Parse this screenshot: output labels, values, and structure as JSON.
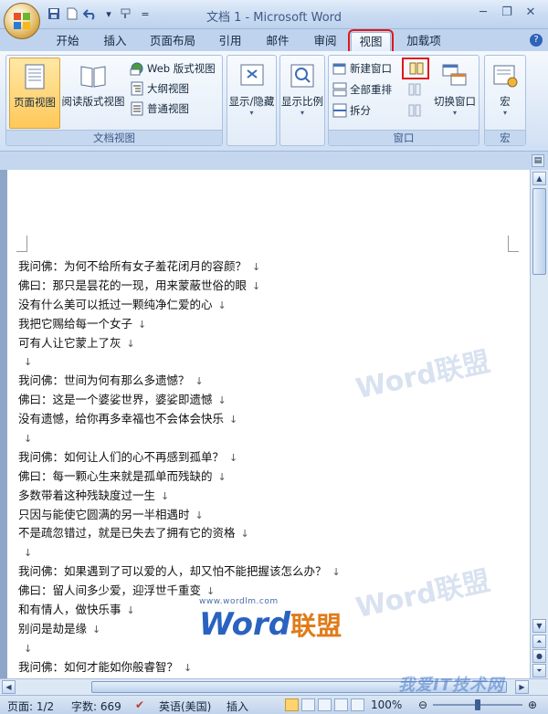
{
  "window": {
    "title": "文档 1 - Microsoft Word"
  },
  "quick_access": [
    "save-icon",
    "new-document-icon",
    "undo-icon",
    "format-painter-icon"
  ],
  "tabs": [
    {
      "label": "开始"
    },
    {
      "label": "插入"
    },
    {
      "label": "页面布局"
    },
    {
      "label": "引用"
    },
    {
      "label": "邮件"
    },
    {
      "label": "审阅"
    },
    {
      "label": "视图",
      "active": true,
      "highlighted": true
    },
    {
      "label": "加载项"
    }
  ],
  "ribbon": {
    "doc_view": {
      "label": "文档视图",
      "print_layout": "页面视图",
      "reading_layout": "阅读版式视图",
      "web_layout": "Web 版式视图",
      "outline": "大纲视图",
      "draft": "普通视图"
    },
    "show_hide": {
      "label": "显示/隐藏"
    },
    "zoom": {
      "label": "显示比例"
    },
    "window": {
      "label": "窗口",
      "new_window": "新建窗口",
      "arrange_all": "全部重排",
      "split": "拆分",
      "switch_windows": "切换窗口"
    },
    "macros": {
      "label": "宏",
      "button": "宏"
    }
  },
  "document": {
    "lines": [
      "我问佛：为何不给所有女子羞花闭月的容颜？",
      "佛曰：那只是昙花的一现，用来蒙蔽世俗的眼",
      "没有什么美可以抵过一颗纯净仁爱的心",
      "我把它赐给每一个女子",
      "可有人让它蒙上了灰",
      "",
      "我问佛：世间为何有那么多遗憾？",
      "佛曰：这是一个婆娑世界，婆娑即遗憾",
      "没有遗憾，给你再多幸福也不会体会快乐",
      "",
      "我问佛：如何让人们的心不再感到孤单？",
      "佛曰：每一颗心生来就是孤单而残缺的",
      "多数带着这种残缺度过一生",
      "只因与能使它圆满的另一半相遇时",
      "不是疏忽错过，就是已失去了拥有它的资格",
      "",
      "我问佛：如果遇到了可以爱的人，却又怕不能把握该怎么办？",
      "佛曰：留人间多少爱，迎浮世千重变",
      "和有情人，做快乐事",
      "别问是劫是缘",
      "",
      "我问佛：如何才能如你般睿智？"
    ],
    "paragraph_mark": "↓",
    "watermark_url": "www.wordlm.com",
    "watermark_word": "Word",
    "watermark_cn": "联盟"
  },
  "status_bar": {
    "page": "页面: 1/2",
    "words": "字数: 669",
    "language": "英语(美国)",
    "mode": "插入",
    "zoom": "100%",
    "zoom_fraction": 0.5,
    "site": "我爱IT技术网"
  }
}
